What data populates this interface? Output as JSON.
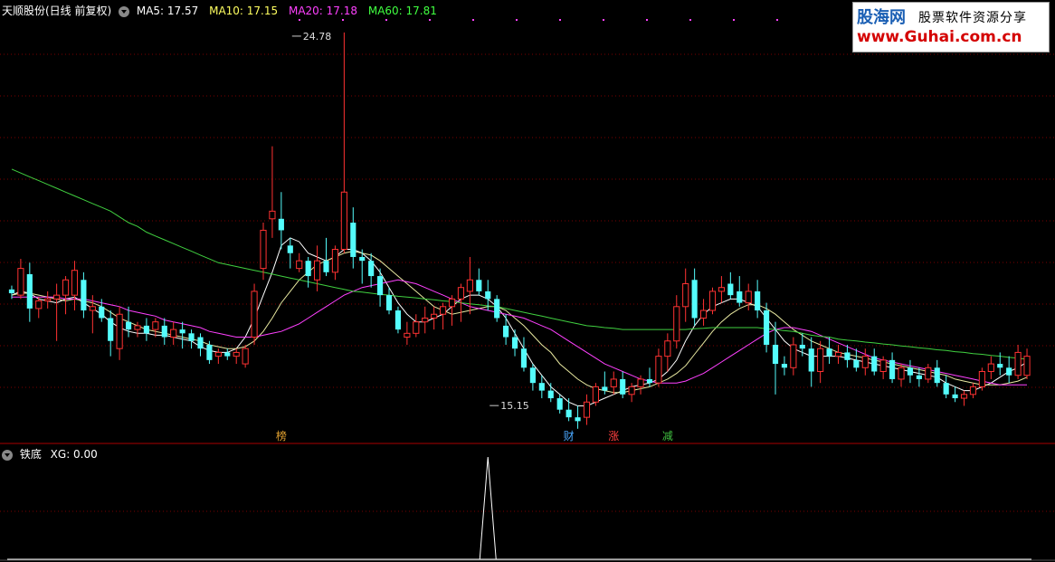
{
  "main_header": {
    "stock_label": "天顺股份(日线 前复权)",
    "ma5": "MA5: 17.57",
    "ma10": "MA10: 17.15",
    "ma20": "MA20: 17.18",
    "ma60": "MA60: 17.81"
  },
  "sub_header": {
    "indicator_label": "铁底",
    "xg_label": "XG: 0.00"
  },
  "watermark": {
    "logo": "股海网",
    "slogan": "股票软件资源分享",
    "url": "www.Guhai.com.cn"
  },
  "event_markers": [
    {
      "label": "榜",
      "color": "#e0a030",
      "index": 30
    },
    {
      "label": "财",
      "color": "#4aa8ff",
      "index": 62
    },
    {
      "label": "涨",
      "color": "#ff4040",
      "index": 67
    },
    {
      "label": "减",
      "color": "#40c040",
      "index": 73
    }
  ],
  "colors": {
    "up": "#ff3232",
    "down": "#54fcfc",
    "ma5": "#ffffff",
    "ma10": "#e8e8a0",
    "ma20": "#ff40ff",
    "ma60": "#40d040",
    "grid": "#7a0000",
    "frame": "#aa0000",
    "header_ma5": "#ffffff",
    "header_ma10": "#ffff60",
    "header_ma20": "#ff40ff",
    "header_ma60": "#40ff40"
  },
  "chart_data": {
    "type": "candlestick",
    "y_range": [
      14.3,
      25.3
    ],
    "high_annotation": {
      "label": "24.78",
      "value": 24.78,
      "index": 31
    },
    "low_annotation": {
      "label": "15.15",
      "value": 15.15,
      "index": 53
    },
    "ohlc": [
      [
        18.05,
        18.15,
        17.8,
        17.95
      ],
      [
        17.9,
        18.85,
        17.8,
        18.6
      ],
      [
        18.45,
        18.75,
        17.2,
        17.55
      ],
      [
        17.55,
        17.85,
        17.3,
        17.75
      ],
      [
        17.75,
        18.0,
        17.55,
        17.8
      ],
      [
        17.8,
        18.2,
        16.7,
        17.9
      ],
      [
        17.9,
        18.4,
        17.4,
        18.3
      ],
      [
        17.9,
        18.8,
        17.5,
        18.55
      ],
      [
        18.3,
        18.5,
        17.3,
        17.5
      ],
      [
        17.5,
        17.9,
        16.9,
        17.6
      ],
      [
        17.6,
        17.8,
        17.2,
        17.3
      ],
      [
        17.3,
        17.5,
        16.3,
        16.7
      ],
      [
        16.5,
        17.6,
        16.2,
        17.4
      ],
      [
        17.2,
        17.6,
        16.8,
        17.0
      ],
      [
        17.0,
        17.2,
        16.8,
        17.1
      ],
      [
        17.1,
        17.3,
        16.7,
        16.9
      ],
      [
        17.0,
        17.3,
        16.8,
        17.2
      ],
      [
        17.1,
        17.3,
        16.6,
        16.8
      ],
      [
        16.8,
        17.2,
        16.6,
        17.0
      ],
      [
        17.0,
        17.2,
        16.5,
        16.9
      ],
      [
        16.9,
        17.0,
        16.5,
        16.7
      ],
      [
        16.8,
        16.9,
        16.3,
        16.5
      ],
      [
        16.6,
        16.7,
        16.1,
        16.2
      ],
      [
        16.3,
        16.5,
        16.1,
        16.4
      ],
      [
        16.4,
        16.5,
        16.2,
        16.3
      ],
      [
        16.3,
        16.5,
        16.1,
        16.4
      ],
      [
        16.1,
        16.6,
        16.0,
        16.5
      ],
      [
        16.8,
        18.2,
        16.6,
        18.0
      ],
      [
        18.6,
        19.8,
        18.3,
        19.6
      ],
      [
        19.9,
        21.8,
        19.4,
        20.1
      ],
      [
        19.9,
        20.6,
        19.1,
        19.6
      ],
      [
        19.2,
        19.4,
        18.6,
        19.0
      ],
      [
        18.6,
        19.0,
        18.5,
        18.8
      ],
      [
        18.8,
        18.9,
        18.1,
        18.4
      ],
      [
        18.3,
        19.2,
        18.0,
        18.8
      ],
      [
        18.8,
        19.4,
        18.4,
        18.5
      ],
      [
        18.5,
        19.2,
        18.3,
        19.1
      ],
      [
        19.1,
        24.78,
        19.0,
        20.6
      ],
      [
        19.8,
        20.2,
        18.6,
        18.9
      ],
      [
        18.9,
        19.1,
        18.2,
        18.8
      ],
      [
        18.8,
        19.0,
        18.1,
        18.4
      ],
      [
        18.4,
        18.6,
        17.6,
        17.9
      ],
      [
        17.9,
        18.1,
        17.4,
        17.5
      ],
      [
        17.5,
        17.6,
        16.9,
        17.0
      ],
      [
        16.8,
        17.2,
        16.6,
        16.9
      ],
      [
        16.9,
        17.4,
        16.8,
        17.2
      ],
      [
        17.2,
        17.6,
        16.9,
        17.3
      ],
      [
        17.3,
        17.6,
        17.0,
        17.4
      ],
      [
        17.4,
        17.7,
        17.0,
        17.6
      ],
      [
        17.6,
        17.9,
        17.1,
        17.8
      ],
      [
        17.8,
        18.2,
        17.2,
        18.1
      ],
      [
        18.0,
        18.9,
        17.4,
        18.3
      ],
      [
        18.3,
        18.6,
        17.9,
        18.0
      ],
      [
        18.0,
        18.3,
        17.5,
        17.8
      ],
      [
        17.8,
        17.9,
        17.2,
        17.3
      ],
      [
        17.1,
        17.4,
        16.6,
        16.8
      ],
      [
        16.8,
        17.0,
        16.3,
        16.5
      ],
      [
        16.5,
        16.8,
        15.9,
        16.0
      ],
      [
        16.0,
        16.1,
        15.4,
        15.6
      ],
      [
        15.6,
        15.8,
        15.2,
        15.4
      ],
      [
        15.4,
        15.6,
        15.1,
        15.2
      ],
      [
        15.2,
        15.3,
        14.8,
        14.9
      ],
      [
        14.9,
        15.2,
        14.6,
        14.7
      ],
      [
        14.7,
        15.0,
        14.4,
        14.6
      ],
      [
        14.7,
        15.3,
        14.5,
        15.1
      ],
      [
        15.1,
        15.6,
        15.0,
        15.5
      ],
      [
        15.5,
        15.9,
        15.3,
        15.4
      ],
      [
        15.5,
        15.9,
        15.3,
        15.7
      ],
      [
        15.7,
        15.9,
        15.2,
        15.3
      ],
      [
        15.3,
        15.6,
        15.1,
        15.5
      ],
      [
        15.5,
        15.8,
        15.3,
        15.7
      ],
      [
        15.7,
        16.0,
        15.5,
        15.6
      ],
      [
        15.6,
        16.5,
        15.5,
        16.3
      ],
      [
        16.3,
        16.9,
        15.9,
        16.7
      ],
      [
        16.7,
        17.9,
        16.5,
        17.6
      ],
      [
        17.6,
        18.6,
        17.2,
        18.2
      ],
      [
        18.3,
        18.6,
        17.1,
        17.3
      ],
      [
        17.3,
        17.8,
        17.1,
        17.5
      ],
      [
        17.5,
        18.1,
        17.4,
        18.0
      ],
      [
        18.0,
        18.4,
        17.7,
        18.1
      ],
      [
        18.2,
        18.5,
        17.8,
        17.9
      ],
      [
        18.0,
        18.4,
        17.6,
        17.7
      ],
      [
        17.7,
        18.2,
        17.5,
        18.0
      ],
      [
        18.0,
        18.3,
        17.3,
        17.5
      ],
      [
        17.5,
        17.7,
        16.4,
        16.6
      ],
      [
        16.6,
        17.2,
        15.3,
        16.1
      ],
      [
        16.1,
        16.3,
        15.8,
        16.0
      ],
      [
        16.0,
        16.8,
        15.8,
        16.6
      ],
      [
        16.6,
        16.9,
        16.3,
        16.5
      ],
      [
        16.5,
        16.8,
        15.5,
        15.9
      ],
      [
        15.9,
        16.7,
        15.6,
        16.5
      ],
      [
        16.5,
        16.8,
        16.1,
        16.3
      ],
      [
        16.3,
        16.6,
        16.1,
        16.4
      ],
      [
        16.4,
        16.6,
        16.0,
        16.2
      ],
      [
        16.2,
        16.5,
        15.9,
        16.0
      ],
      [
        16.0,
        16.5,
        15.8,
        16.3
      ],
      [
        16.3,
        16.5,
        15.8,
        15.9
      ],
      [
        15.9,
        16.3,
        15.7,
        16.2
      ],
      [
        16.2,
        16.4,
        15.6,
        15.7
      ],
      [
        15.7,
        16.1,
        15.5,
        16.0
      ],
      [
        16.0,
        16.2,
        15.6,
        15.8
      ],
      [
        15.8,
        16.0,
        15.5,
        15.7
      ],
      [
        15.7,
        16.1,
        15.6,
        16.0
      ],
      [
        16.0,
        16.2,
        15.5,
        15.6
      ],
      [
        15.6,
        15.8,
        15.2,
        15.3
      ],
      [
        15.3,
        15.5,
        15.1,
        15.2
      ],
      [
        15.2,
        15.4,
        15.0,
        15.3
      ],
      [
        15.3,
        15.6,
        15.2,
        15.5
      ],
      [
        15.5,
        16.0,
        15.4,
        15.9
      ],
      [
        15.9,
        16.3,
        15.7,
        16.1
      ],
      [
        16.1,
        16.4,
        15.8,
        16.0
      ],
      [
        16.0,
        16.3,
        15.6,
        15.8
      ],
      [
        15.8,
        16.6,
        15.7,
        16.4
      ],
      [
        15.8,
        16.5,
        15.7,
        16.3
      ]
    ],
    "ma_lines": [
      {
        "key": "ma5",
        "values": [
          17.9,
          18.0,
          17.95,
          17.8,
          17.75,
          17.7,
          17.8,
          17.85,
          17.7,
          17.55,
          17.4,
          17.2,
          17.05,
          16.95,
          16.9,
          16.9,
          16.85,
          16.85,
          16.8,
          16.75,
          16.7,
          16.55,
          16.45,
          16.4,
          16.4,
          16.5,
          16.8,
          17.3,
          17.9,
          18.5,
          19.2,
          19.4,
          19.3,
          19.0,
          18.9,
          18.8,
          18.9,
          19.1,
          19.1,
          19.0,
          18.8,
          18.5,
          18.1,
          17.7,
          17.4,
          17.2,
          17.2,
          17.3,
          17.4,
          17.6,
          17.8,
          17.9,
          17.9,
          17.8,
          17.6,
          17.3,
          16.9,
          16.5,
          16.1,
          15.8,
          15.5,
          15.3,
          15.1,
          15.0,
          15.0,
          15.1,
          15.2,
          15.3,
          15.4,
          15.5,
          15.55,
          15.6,
          15.7,
          15.9,
          16.2,
          16.7,
          17.1,
          17.4,
          17.6,
          17.7,
          17.8,
          17.8,
          17.7,
          17.6,
          17.3,
          17.0,
          16.7,
          16.5,
          16.4,
          16.3,
          16.3,
          16.3,
          16.3,
          16.25,
          16.2,
          16.15,
          16.1,
          16.05,
          16.0,
          15.95,
          15.9,
          15.85,
          15.8,
          15.75,
          15.6,
          15.5,
          15.4,
          15.4,
          15.5,
          15.6,
          15.75,
          15.9,
          16.0,
          16.15
        ]
      },
      {
        "key": "ma10",
        "values": [
          17.9,
          17.95,
          17.95,
          17.9,
          17.85,
          17.8,
          17.75,
          17.8,
          17.75,
          17.7,
          17.6,
          17.45,
          17.3,
          17.2,
          17.1,
          17.0,
          16.95,
          16.9,
          16.85,
          16.8,
          16.75,
          16.7,
          16.6,
          16.55,
          16.5,
          16.5,
          16.55,
          16.7,
          16.95,
          17.3,
          17.7,
          18.0,
          18.3,
          18.5,
          18.7,
          18.8,
          18.9,
          19.0,
          19.05,
          19.0,
          18.95,
          18.8,
          18.6,
          18.4,
          18.2,
          18.0,
          17.8,
          17.6,
          17.5,
          17.4,
          17.45,
          17.5,
          17.55,
          17.6,
          17.6,
          17.5,
          17.3,
          17.1,
          16.85,
          16.6,
          16.4,
          16.1,
          15.9,
          15.7,
          15.55,
          15.45,
          15.4,
          15.35,
          15.35,
          15.4,
          15.45,
          15.5,
          15.6,
          15.7,
          15.85,
          16.05,
          16.35,
          16.65,
          16.95,
          17.2,
          17.4,
          17.55,
          17.65,
          17.65,
          17.55,
          17.4,
          17.2,
          17.0,
          16.85,
          16.7,
          16.6,
          16.5,
          16.4,
          16.35,
          16.3,
          16.25,
          16.2,
          16.15,
          16.1,
          16.05,
          16.0,
          15.95,
          15.9,
          15.85,
          15.8,
          15.7,
          15.65,
          15.6,
          15.55,
          15.55,
          15.55,
          15.6,
          15.65,
          15.75
        ]
      },
      {
        "key": "ma20",
        "values": [
          17.85,
          17.85,
          17.85,
          17.85,
          17.85,
          17.85,
          17.8,
          17.8,
          17.8,
          17.75,
          17.7,
          17.65,
          17.6,
          17.5,
          17.45,
          17.4,
          17.35,
          17.25,
          17.2,
          17.15,
          17.1,
          17.05,
          16.95,
          16.9,
          16.85,
          16.8,
          16.8,
          16.8,
          16.85,
          16.9,
          16.95,
          17.05,
          17.15,
          17.3,
          17.45,
          17.6,
          17.75,
          17.9,
          18.0,
          18.1,
          18.15,
          18.2,
          18.25,
          18.3,
          18.25,
          18.2,
          18.1,
          18.0,
          17.9,
          17.8,
          17.7,
          17.6,
          17.55,
          17.5,
          17.45,
          17.4,
          17.35,
          17.3,
          17.2,
          17.1,
          17.0,
          16.85,
          16.7,
          16.55,
          16.4,
          16.25,
          16.1,
          16.0,
          15.9,
          15.8,
          15.7,
          15.65,
          15.6,
          15.6,
          15.6,
          15.65,
          15.75,
          15.85,
          16.0,
          16.15,
          16.3,
          16.45,
          16.6,
          16.75,
          16.9,
          17.0,
          17.05,
          17.05,
          17.0,
          16.95,
          16.85,
          16.75,
          16.65,
          16.55,
          16.45,
          16.35,
          16.25,
          16.2,
          16.15,
          16.1,
          16.05,
          16.0,
          15.95,
          15.9,
          15.85,
          15.8,
          15.75,
          15.7,
          15.65,
          15.6,
          15.55,
          15.55,
          15.55,
          15.55
        ]
      },
      {
        "key": "ma60",
        "values": [
          21.2,
          21.1,
          21.0,
          20.9,
          20.8,
          20.7,
          20.6,
          20.5,
          20.4,
          20.3,
          20.2,
          20.1,
          19.95,
          19.8,
          19.7,
          19.55,
          19.45,
          19.35,
          19.25,
          19.15,
          19.05,
          18.95,
          18.85,
          18.75,
          18.7,
          18.65,
          18.6,
          18.55,
          18.5,
          18.45,
          18.4,
          18.35,
          18.3,
          18.25,
          18.2,
          18.15,
          18.1,
          18.05,
          18.0,
          17.98,
          17.95,
          17.92,
          17.9,
          17.87,
          17.85,
          17.83,
          17.8,
          17.78,
          17.75,
          17.73,
          17.7,
          17.67,
          17.65,
          17.62,
          17.6,
          17.55,
          17.5,
          17.45,
          17.4,
          17.35,
          17.3,
          17.25,
          17.2,
          17.15,
          17.1,
          17.08,
          17.05,
          17.03,
          17.0,
          17.0,
          17.0,
          17.0,
          17.0,
          17.0,
          17.0,
          17.0,
          17.02,
          17.03,
          17.05,
          17.05,
          17.05,
          17.05,
          17.05,
          17.05,
          17.02,
          17.0,
          16.97,
          16.95,
          16.9,
          16.85,
          16.82,
          16.8,
          16.75,
          16.72,
          16.7,
          16.67,
          16.65,
          16.62,
          16.6,
          16.57,
          16.55,
          16.52,
          16.5,
          16.47,
          16.45,
          16.42,
          16.4,
          16.37,
          16.35,
          16.32,
          16.3,
          16.27,
          16.25,
          16.22
        ]
      }
    ],
    "indicator": {
      "name": "铁底 XG",
      "y_range": [
        0,
        1
      ],
      "spike_index": 53,
      "spike_value": 1
    }
  }
}
